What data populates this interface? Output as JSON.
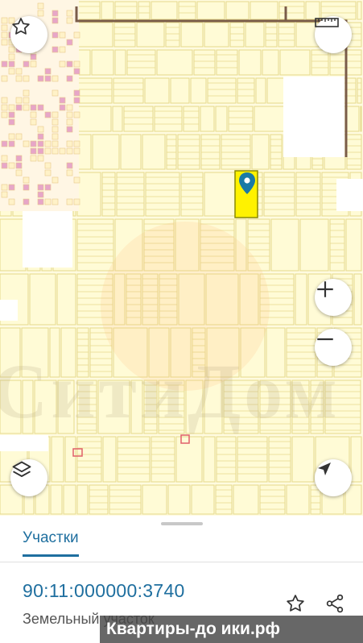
{
  "map": {
    "watermark_text": "СитиДом",
    "selected_parcel_color": "#fff200",
    "parcel_fill": "#fffbd6",
    "parcel_stroke": "#e6d98a",
    "boundary_color": "#7a5c4a",
    "marker_color": "#1a7aa6"
  },
  "controls": {
    "favorite": "star-icon",
    "ruler": "ruler-icon",
    "zoom_in": "plus-icon",
    "zoom_out": "minus-icon",
    "layers": "layers-icon",
    "locate": "navigation-arrow-icon"
  },
  "panel": {
    "tab_label": "Участки",
    "cadastral_number": "90:11:000000:3740",
    "parcel_type": "Земельный участок",
    "accent_color": "#1f6f9f"
  },
  "banner": {
    "text": "Квартиры-до  ики.рф"
  }
}
